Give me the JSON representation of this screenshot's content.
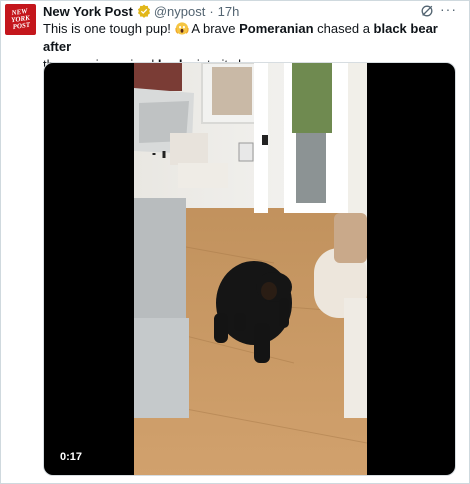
{
  "post": {
    "author_name": "New York Post",
    "avatar_text": "NEW YORK POST",
    "handle": "@nypost",
    "separator": "·",
    "time": "17h",
    "text_parts": {
      "p1": "This is one tough pup! ",
      "p2": " A brave ",
      "b1": "Pomeranian",
      "p3": " chased a ",
      "b2": "black bear after",
      "p4": " the massive animal ",
      "b3": "broke",
      "p5": " into its home."
    },
    "more_label": "···"
  },
  "video": {
    "duration": "0:17"
  },
  "icons": {
    "verified": "verified-badge-icon",
    "grok": "grok-icon",
    "more": "more-options-icon",
    "emoji": "screaming-face-emoji"
  },
  "colors": {
    "brand": "#c4161c",
    "verified": "#e2b719",
    "text": "#0f1419",
    "muted": "#536471"
  }
}
